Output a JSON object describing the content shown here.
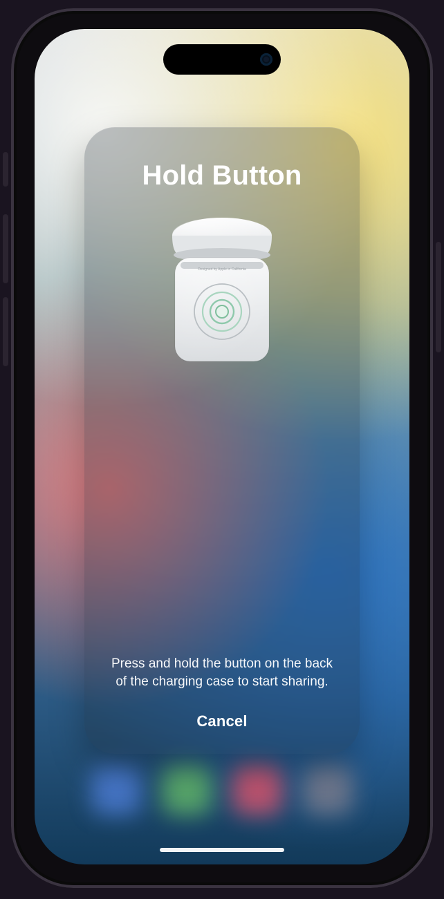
{
  "modal": {
    "title": "Hold Button",
    "body": "Press and hold the button on the back of the charging case to start sharing.",
    "cancel_label": "Cancel"
  },
  "icons": {
    "airpods_case": "airpods-case-icon"
  }
}
